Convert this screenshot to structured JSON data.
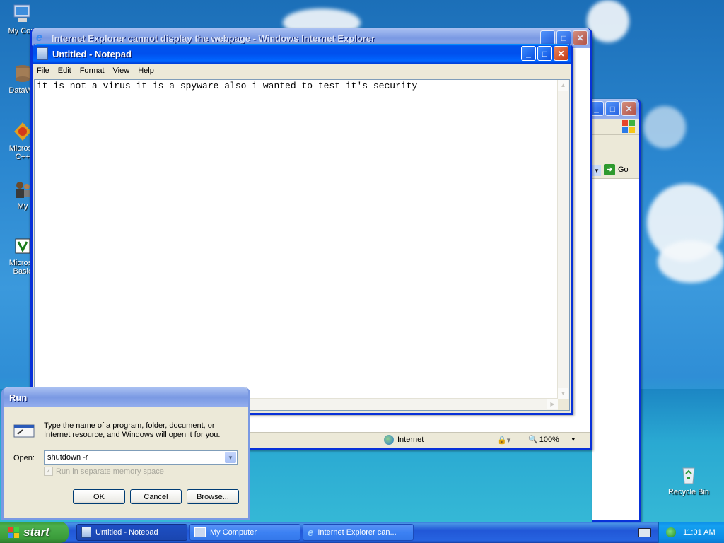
{
  "desktop": {
    "icons": [
      {
        "label": "My Com"
      },
      {
        "label": "DataWa"
      },
      {
        "label": "Microso C++"
      },
      {
        "label": "My"
      },
      {
        "label": "Microso Basic"
      },
      {
        "label": "Recycle Bin"
      }
    ]
  },
  "ie_window": {
    "title": "Internet Explorer cannot display the webpage - Windows Internet Explorer",
    "status_zone": "Internet",
    "zoom": "100%"
  },
  "mycomputer_window": {
    "go_label": "Go"
  },
  "notepad": {
    "title": "Untitled - Notepad",
    "menu": [
      "File",
      "Edit",
      "Format",
      "View",
      "Help"
    ],
    "content": "it is not a virus it is a spyware also i wanted to test it's security"
  },
  "run_dialog": {
    "title": "Run",
    "description": "Type the name of a program, folder, document, or Internet resource, and Windows will open it for you.",
    "open_label": "Open:",
    "open_value": "shutdown -r",
    "checkbox_label": "Run in separate memory space",
    "ok": "OK",
    "cancel": "Cancel",
    "browse": "Browse..."
  },
  "taskbar": {
    "start": "start",
    "tasks": [
      {
        "label": "Untitled - Notepad"
      },
      {
        "label": "My Computer"
      },
      {
        "label": "Internet Explorer can..."
      }
    ],
    "clock": "11:01 AM"
  }
}
